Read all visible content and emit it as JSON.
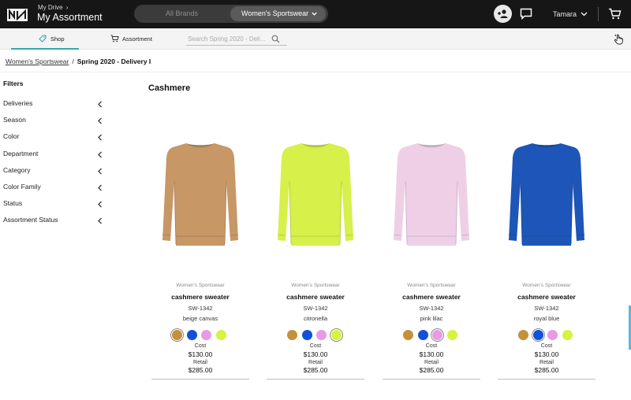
{
  "header": {
    "drive_label": "My Drive",
    "app_title": "My Assortment",
    "brand_toggle": {
      "all": "All Brands",
      "active": "Women's Sportswear"
    },
    "user_name": "Tamara"
  },
  "subnav": {
    "tabs": [
      {
        "label": "Shop",
        "icon": "tag-icon",
        "active": true
      },
      {
        "label": "Assortment",
        "icon": "cart-icon",
        "active": false
      }
    ],
    "search": {
      "placeholder": "Search Spring 2020 - Deli...",
      "value": ""
    }
  },
  "breadcrumb": {
    "parent": "Women's Sportswear",
    "current": "Spring 2020 - Delivery I"
  },
  "filters": {
    "title": "Filters",
    "items": [
      "Deliveries",
      "Season",
      "Color",
      "Department",
      "Category",
      "Color Family",
      "Status",
      "Assortment Status"
    ]
  },
  "section_title": "Cashmere",
  "swatch_colors": [
    "#c4913a",
    "#1151d8",
    "#e79ae6",
    "#d7f23f"
  ],
  "products": [
    {
      "brand": "Women's Sportswear",
      "name": "cashmere sweater",
      "sku": "SW-1342",
      "color": "beige canvas",
      "sweater_color": "#c79766",
      "selected_swatch": 0,
      "cost_label": "Cost",
      "cost": "$130.00",
      "retail_label": "Retail",
      "retail": "$285.00"
    },
    {
      "brand": "Women's Sportswear",
      "name": "cashmere sweater",
      "sku": "SW-1342",
      "color": "citronella",
      "sweater_color": "#d7f04a",
      "selected_swatch": 3,
      "cost_label": "Cost",
      "cost": "$130.00",
      "retail_label": "Retail",
      "retail": "$285.00"
    },
    {
      "brand": "Women's Sportswear",
      "name": "cashmere sweater",
      "sku": "SW-1342",
      "color": "pink lilac",
      "sweater_color": "#efcfe6",
      "selected_swatch": 2,
      "cost_label": "Cost",
      "cost": "$130.00",
      "retail_label": "Retail",
      "retail": "$285.00"
    },
    {
      "brand": "Women's Sportswear",
      "name": "cashmere sweater",
      "sku": "SW-1342",
      "color": "royal blue",
      "sweater_color": "#1d56b8",
      "selected_swatch": 1,
      "cost_label": "Cost",
      "cost": "$130.00",
      "retail_label": "Retail",
      "retail": "$285.00"
    }
  ]
}
